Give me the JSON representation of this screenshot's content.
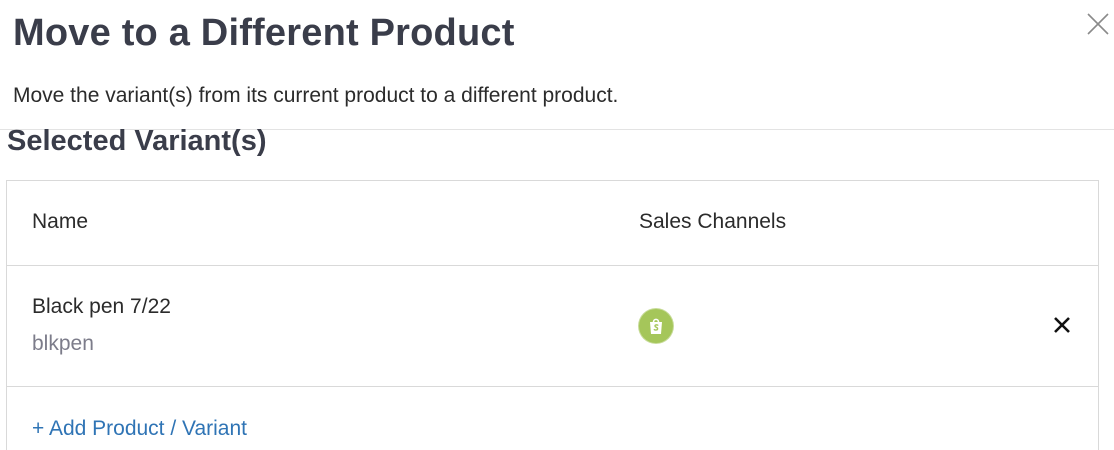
{
  "modal": {
    "title": "Move to a Different Product",
    "description": "Move the variant(s) from its current product to a different product.",
    "close_icon": "close-icon"
  },
  "section": {
    "title": "Selected Variant(s)"
  },
  "table": {
    "columns": [
      "Name",
      "Sales Channels"
    ],
    "rows": [
      {
        "name": "Black pen 7/22",
        "sku": "blkpen",
        "channel_icon": "shopify-icon",
        "remove_icon": "remove-icon"
      }
    ]
  },
  "add_link": "+ Add Product / Variant",
  "colors": {
    "title": "#3a3d4a",
    "link": "#2f74b5",
    "shopify_green": "#a5c65a",
    "sku_gray": "#7c7c8a"
  }
}
